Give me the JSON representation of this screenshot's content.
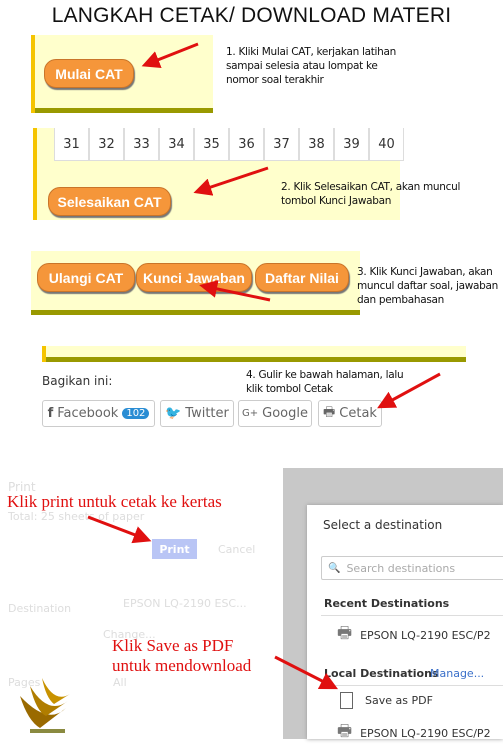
{
  "title": "LANGKAH CETAK/ DOWNLOAD MATERI",
  "step1": {
    "button": "Mulai CAT",
    "note": "1. Kliki Mulai CAT, kerjakan latihan sampai selesia atau lompat ke nomor soal terakhir"
  },
  "step2": {
    "numbers": [
      "31",
      "32",
      "33",
      "34",
      "35",
      "36",
      "37",
      "38",
      "39",
      "40"
    ],
    "button": "Selesaikan CAT",
    "note": "2. Klik Selesaikan CAT, akan muncul tombol Kunci Jawaban"
  },
  "step3": {
    "buttons": [
      "Ulangi CAT",
      "Kunci Jawaban",
      "Daftar Nilai"
    ],
    "note": "3. Klik Kunci Jawaban, akan muncul daftar soal, jawaban dan pembahasan"
  },
  "step4": {
    "share_label": "Bagikan ini:",
    "facebook": "Facebook",
    "facebook_count": "102",
    "twitter": "Twitter",
    "google": "Google",
    "cetak": "Cetak",
    "note": "4. Gulir ke bawah halaman, lalu klik tombol Cetak"
  },
  "print": {
    "heading": "Print",
    "total": "Total: 25 sheets of paper",
    "print_button": "Print",
    "cancel": "Cancel",
    "destination_label": "Destination",
    "destination_value": "EPSON LQ-2190 ESC...",
    "change": "Change...",
    "pages_label": "Pages",
    "pages_value": "All"
  },
  "annotations": {
    "print_note": "Klik print untuk cetak ke kertas",
    "pdf_note_1": "Klik Save as PDF",
    "pdf_note_2": "untuk mendownload"
  },
  "dialog": {
    "title": "Select a destination",
    "search_placeholder": "Search destinations",
    "recent": "Recent Destinations",
    "recent_item": "EPSON LQ-2190 ESC/P2",
    "local": "Local Destinations",
    "manage": "Manage...",
    "local_items": [
      "Save as PDF",
      "EPSON LQ-2190 ESC/P2"
    ]
  },
  "colors": {
    "button": "#f5963a",
    "panel": "#ffffcc",
    "bar": "#999900",
    "arrow": "#e01010"
  }
}
